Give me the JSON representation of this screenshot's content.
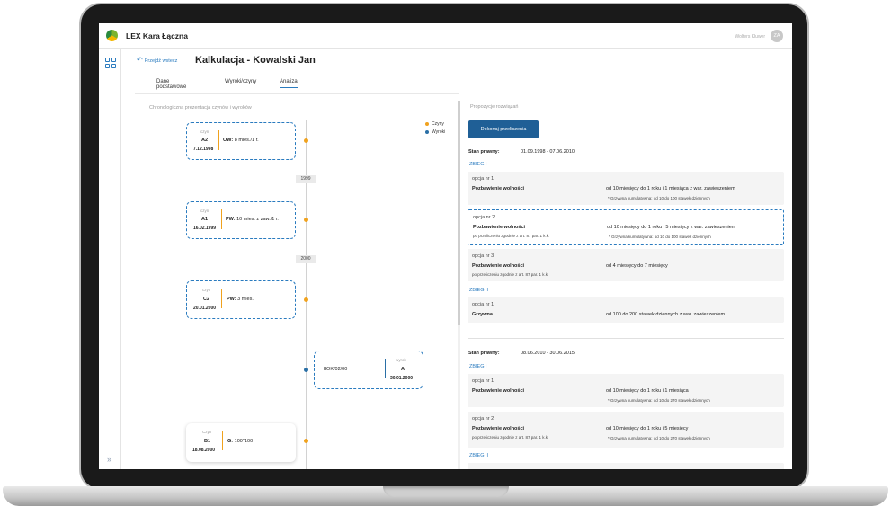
{
  "app": {
    "title": "LEX Kara Łączna",
    "brand": "Wolters Kluwer",
    "avatar": "ZA"
  },
  "header": {
    "back_label": "Przejdź wstecz",
    "title": "Kalkulacja - Kowalski Jan"
  },
  "tabs": [
    {
      "label": "Dane podstawowe",
      "active": false
    },
    {
      "label": "Wyroki/czyny",
      "active": false
    },
    {
      "label": "Analiza",
      "active": true
    }
  ],
  "left": {
    "label": "Chronologiczna prezentacja czynów i wyroków",
    "legend": {
      "czyny": "Czyny",
      "wyroki": "Wyroki"
    },
    "years": [
      "1999",
      "2000"
    ],
    "cards": [
      {
        "type": "czyn",
        "code": "A2",
        "date": "7.12.1998",
        "desc_key": "OW:",
        "desc": " 8 mies./1 r."
      },
      {
        "type": "czyn",
        "code": "A1",
        "date": "16.02.1999",
        "desc_key": "PW:",
        "desc": " 10 mies. z zaw./1 r."
      },
      {
        "type": "czyn",
        "code": "C2",
        "date": "20.01.2000",
        "desc_key": "PW:",
        "desc": " 3 mies."
      },
      {
        "type": "wyrok",
        "code": "A",
        "date": "30.01.2000",
        "desc_key": "",
        "desc": "IIOK/02/00"
      },
      {
        "type": "Czyn",
        "code": "B1",
        "date": "18.08.2000",
        "desc_key": "G:",
        "desc": " 100*100"
      }
    ]
  },
  "right": {
    "label": "Propozycje rozwiązań",
    "calc_button": "Dokonaj przeliczenia",
    "states": [
      {
        "label": "Stan prawny:",
        "dates": "01.09.1998 - 07.06.2010"
      },
      {
        "label": "Stan prawny:",
        "dates": "08.06.2010 - 30.06.2015"
      }
    ],
    "zbieg": [
      "ZBIEG I",
      "ZBIEG II",
      "ZBIEG I",
      "ZBIEG II"
    ],
    "options": [
      {
        "label": "opcja nr 1",
        "penalty": "Pozbawienie wolności",
        "sub": "",
        "value": "od 10 miesięcy do 1 roku i 1 miesiąca z war. zawieszeniem",
        "note": "* Grzywna kumulatywna: od 10 do 100 stawek dziennych"
      },
      {
        "label": "opcja nr 2",
        "penalty": "Pozbawienie wolności",
        "sub": "po przeliczeniu zgodnie z art. 87 par. 1 k.k.",
        "value": "od 10 miesięcy do 1 roku i 5 miesięcy z war. zawieszeniem",
        "note": "* Grzywna kumulatywna: od 10 do 100 stawek dziennych"
      },
      {
        "label": "opcja nr 3",
        "penalty": "Pozbawienie wolności",
        "sub": "po przeliczeniu zgodnie z art. 87 par. 1 k.k.",
        "value": "od 4 miesięcy do 7 miesięcy",
        "note": ""
      },
      {
        "label": "opcja nr 1",
        "penalty": "Grzywna",
        "sub": "",
        "value": "od 100 do 200 stawek dziennych z war. zawieszeniem",
        "note": ""
      },
      {
        "label": "opcja nr 1",
        "penalty": "Pozbawienie wolności",
        "sub": "",
        "value": "od 10 miesięcy do 1 roku i 1 miesiąca",
        "note": "* Grzywna kumulatywna: od 10 do 270 stawek dziennych"
      },
      {
        "label": "opcja nr 2",
        "penalty": "Pozbawienie wolności",
        "sub": "po przeliczeniu zgodnie z art. 87 par. 1 k.k.",
        "value": "od 10 miesięcy do 1 roku i 5 miesięcy",
        "note": "* Grzywna kumulatywna: od 10 do 270 stawek dziennych"
      }
    ]
  },
  "colors": {
    "accent": "#2a7bbf",
    "button": "#1f5f96",
    "czyn": "#f0a21e",
    "wyrok": "#2a6fa6"
  }
}
